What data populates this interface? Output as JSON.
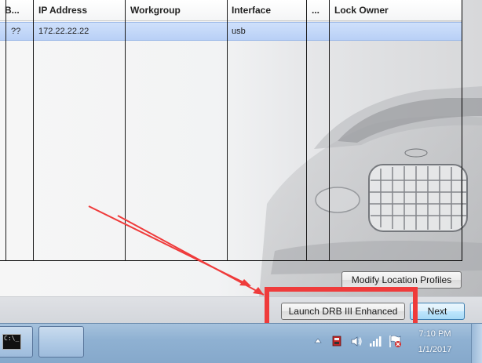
{
  "table": {
    "columns": [
      "B...",
      "IP Address",
      "Workgroup",
      "Interface",
      "...",
      "Lock Owner"
    ],
    "rows": [
      {
        "b": "??",
        "ip": "172.22.22.22",
        "workgroup": "",
        "interface": "usb",
        "more": "",
        "lock_owner": ""
      }
    ]
  },
  "buttons": {
    "modify_label": "Modify Location Profiles",
    "launch_label": "Launch DRB III Enhanced",
    "next_label": "Next"
  },
  "taskbar": {
    "cmd_icon_text": "C:\\_",
    "clock_time": "7:10 PM",
    "clock_date": "1/1/2017",
    "tray_icons": [
      "show-hidden-icons-arrow",
      "device-icon",
      "speaker-icon",
      "network-signal-icon",
      "action-center-flag-icon"
    ]
  },
  "annotation": {
    "highlight_color": "#ef3b3b",
    "arrow_color": "#ef3b3b"
  }
}
